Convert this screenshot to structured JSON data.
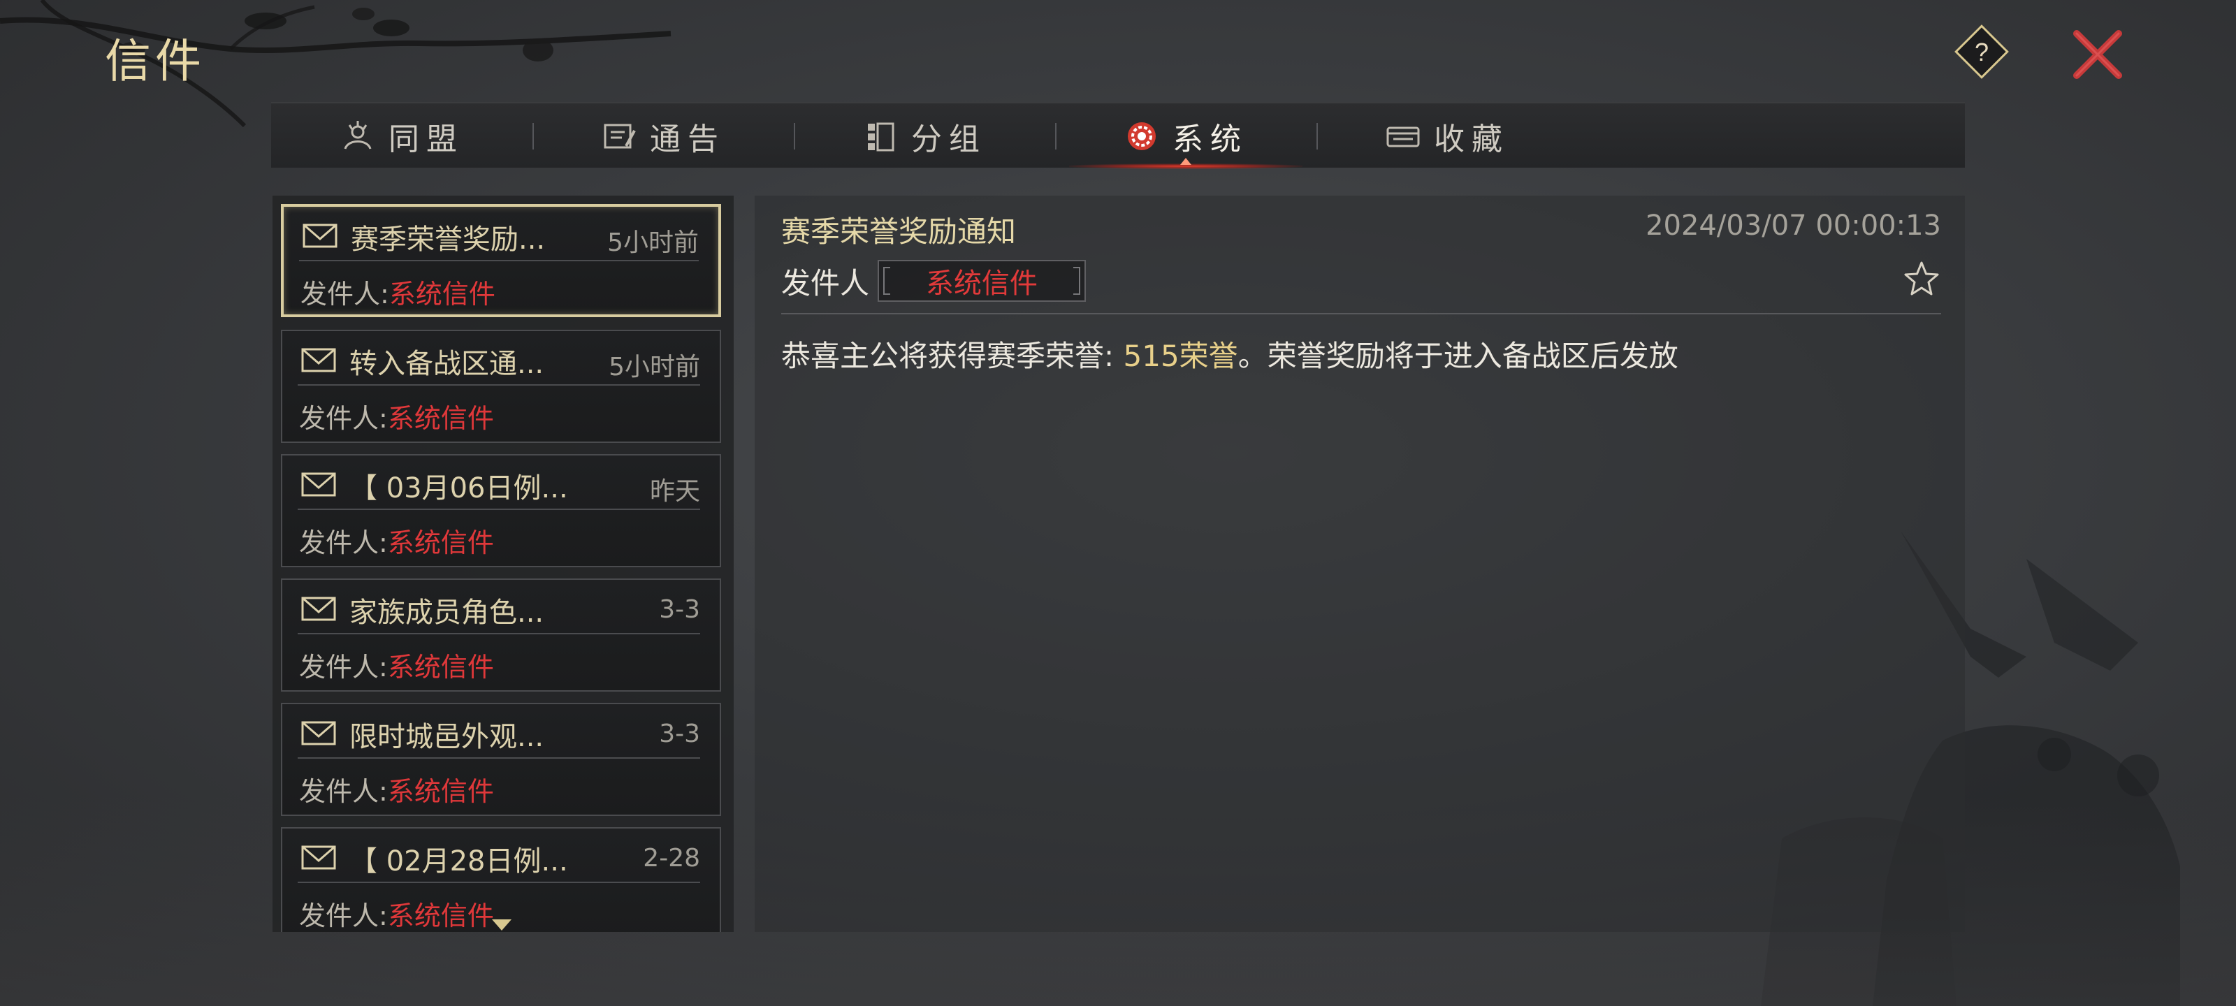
{
  "header": {
    "title": "信件"
  },
  "tabs": [
    {
      "label": "同盟",
      "icon": "alliance-icon",
      "active": false
    },
    {
      "label": "通告",
      "icon": "announcement-icon",
      "active": false
    },
    {
      "label": "分组",
      "icon": "group-icon",
      "active": false
    },
    {
      "label": "系统",
      "icon": "system-gear-icon",
      "active": true
    },
    {
      "label": "收藏",
      "icon": "favorites-icon",
      "active": false
    }
  ],
  "mail_list": {
    "sender_prefix": "发件人:",
    "items": [
      {
        "subject": "赛季荣誉奖励...",
        "time": "5小时前",
        "sender": "系统信件",
        "selected": true
      },
      {
        "subject": "转入备战区通...",
        "time": "5小时前",
        "sender": "系统信件",
        "selected": false
      },
      {
        "subject": "【 03月06日例...",
        "time": "昨天",
        "sender": "系统信件",
        "selected": false
      },
      {
        "subject": "家族成员角色...",
        "time": "3-3",
        "sender": "系统信件",
        "selected": false
      },
      {
        "subject": "限时城邑外观...",
        "time": "3-3",
        "sender": "系统信件",
        "selected": false
      },
      {
        "subject": "【 02月28日例...",
        "time": "2-28",
        "sender": "系统信件",
        "selected": false
      }
    ]
  },
  "detail": {
    "subject": "赛季荣誉奖励通知",
    "datetime": "2024/03/07 00:00:13",
    "sender_label": "发件人",
    "sender_name": "系统信件",
    "body_before": "恭喜主公将获得赛季荣誉: ",
    "body_highlight": "515荣誉",
    "body_after": "。荣誉奖励将于进入备战区后发放"
  },
  "colors": {
    "accent_gold": "#e8d08a",
    "sender_red": "#e0383a",
    "close_red": "#c83a3a",
    "active_tab_glow": "#e03a2a"
  }
}
